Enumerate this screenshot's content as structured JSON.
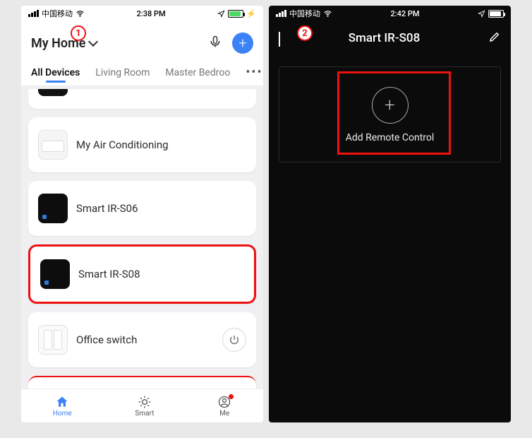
{
  "left": {
    "status": {
      "carrier": "中国移动",
      "time": "2:38 PM"
    },
    "header": {
      "title": "My Home"
    },
    "tabs": [
      "All Devices",
      "Living Room",
      "Master Bedroo"
    ],
    "devices": {
      "ac": "My Air Conditioning",
      "ir06": "Smart IR-S06",
      "ir08": "Smart IR-S08",
      "switch": "Office switch"
    },
    "nav": {
      "home": "Home",
      "smart": "Smart",
      "me": "Me"
    },
    "step": "1"
  },
  "right": {
    "status": {
      "carrier": "中国移动",
      "time": "2:42 PM"
    },
    "title": "Smart IR-S08",
    "addLabel": "Add Remote Control",
    "step": "2"
  }
}
